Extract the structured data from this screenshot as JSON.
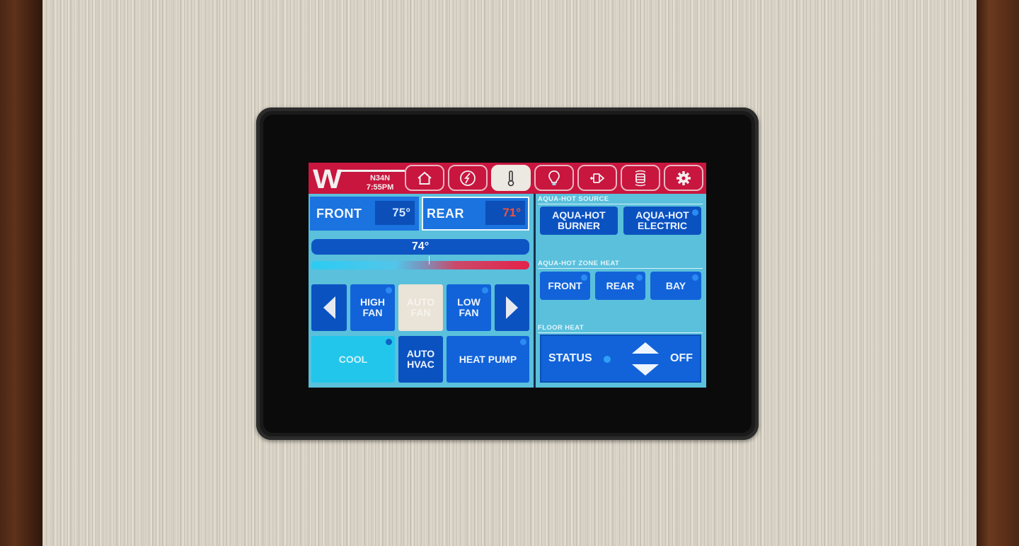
{
  "header": {
    "logo_letter": "W",
    "unit_id": "N34N",
    "time": "7:55PM",
    "nav": [
      {
        "name": "home",
        "icon": "house-icon",
        "active": false
      },
      {
        "name": "power",
        "icon": "lightning-bolt-icon",
        "active": false
      },
      {
        "name": "climate",
        "icon": "thermometer-icon",
        "active": true
      },
      {
        "name": "lighting",
        "icon": "lightbulb-icon",
        "active": false
      },
      {
        "name": "slides",
        "icon": "slide-out-icon",
        "active": false
      },
      {
        "name": "tanks",
        "icon": "tank-icon",
        "active": false
      },
      {
        "name": "settings",
        "icon": "gear-icon",
        "active": false
      }
    ]
  },
  "climate": {
    "zones": [
      {
        "label": "FRONT",
        "temp": "75°",
        "selected": false
      },
      {
        "label": "REAR",
        "temp": "71°",
        "selected": true
      }
    ],
    "setpoint": "74°",
    "fan_prev_label": "previous",
    "fan_next_label": "next",
    "fan_modes": [
      {
        "label": "HIGH FAN",
        "line1": "HIGH",
        "line2": "FAN",
        "state": "available"
      },
      {
        "label": "AUTO FAN",
        "line1": "AUTO",
        "line2": "FAN",
        "state": "selected"
      },
      {
        "label": "LOW FAN",
        "line1": "LOW",
        "line2": "FAN",
        "state": "available"
      }
    ],
    "hvac_modes": [
      {
        "label": "COOL",
        "state": "selected"
      },
      {
        "label": "AUTO HVAC",
        "line1": "AUTO",
        "line2": "HVAC",
        "state": "available"
      },
      {
        "label": "HEAT PUMP",
        "state": "available"
      }
    ]
  },
  "aqua_hot": {
    "source_title": "AQUA-HOT SOURCE",
    "sources": [
      {
        "line1": "AQUA-HOT",
        "line2": "BURNER",
        "indicator": false
      },
      {
        "line1": "AQUA-HOT",
        "line2": "ELECTRIC",
        "indicator": true
      }
    ],
    "zone_title": "AQUA-HOT ZONE HEAT",
    "zones": [
      "FRONT",
      "REAR",
      "BAY"
    ]
  },
  "floor_heat": {
    "title": "FLOOR HEAT",
    "status_label": "STATUS",
    "value": "OFF"
  },
  "colors": {
    "header_red": "#c8163e",
    "screen_bg": "#5ac0dc",
    "button_blue": "#1263d9",
    "selected_beige": "#e9e3d8",
    "cool_cyan": "#22c6ea",
    "warm_temp_red": "#f0523c"
  }
}
